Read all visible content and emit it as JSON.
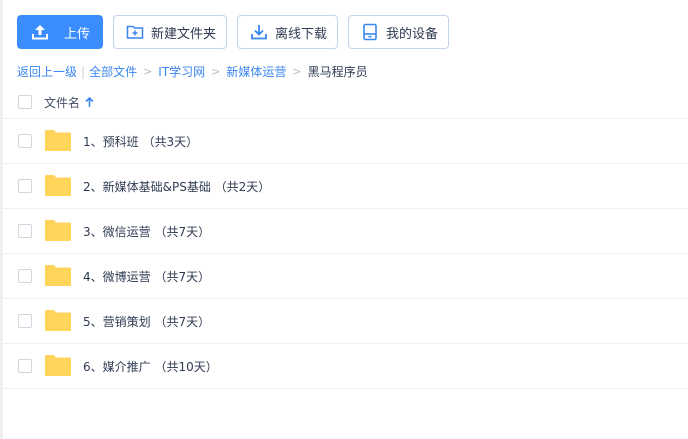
{
  "toolbar": {
    "upload_label": "上传",
    "new_folder_label": "新建文件夹",
    "offline_download_label": "离线下载",
    "my_devices_label": "我的设备"
  },
  "breadcrumb": {
    "back_label": "返回上一级",
    "items": [
      "全部文件",
      "IT学习网",
      "新媒体运营"
    ],
    "current": "黑马程序员"
  },
  "list": {
    "header_label": "文件名",
    "rows": [
      {
        "name": "1、预科班 （共3天）"
      },
      {
        "name": "2、新媒体基础&PS基础 （共2天）"
      },
      {
        "name": "3、微信运营 （共7天）"
      },
      {
        "name": "4、微博运营 （共7天）"
      },
      {
        "name": "5、营销策划 （共7天）"
      },
      {
        "name": "6、媒介推广 （共10天）"
      }
    ]
  },
  "colors": {
    "primary": "#3b8cff",
    "folder": "#ffd35c",
    "link": "#3a86f0"
  }
}
